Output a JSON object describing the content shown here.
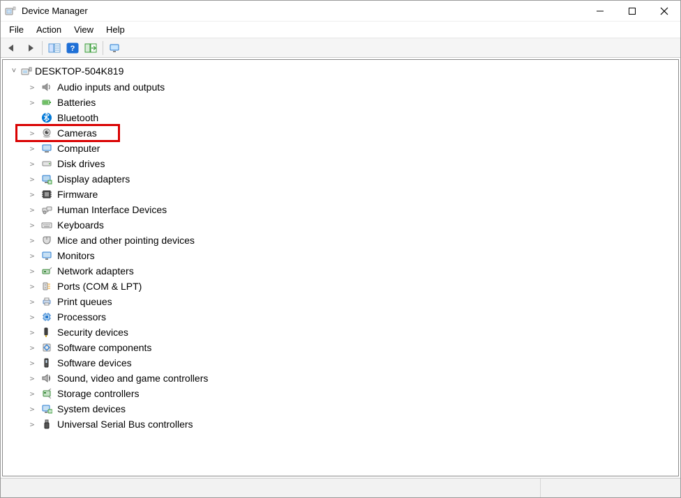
{
  "window": {
    "title": "Device Manager"
  },
  "menu": {
    "file": "File",
    "action": "Action",
    "view": "View",
    "help": "Help"
  },
  "toolbar": {
    "back": "back",
    "forward": "forward",
    "show_hide_console": "show-hide-console-tree",
    "help": "help",
    "scan": "scan-for-hardware-changes",
    "monitor": "display-legacy"
  },
  "tree": {
    "root": "DESKTOP-504K819",
    "categories": [
      {
        "label": "Audio inputs and outputs",
        "icon": "speaker-icon",
        "highlighted": false
      },
      {
        "label": "Batteries",
        "icon": "battery-icon",
        "highlighted": false
      },
      {
        "label": "Bluetooth",
        "icon": "bluetooth-icon",
        "highlighted": false,
        "no_chev": true
      },
      {
        "label": "Cameras",
        "icon": "camera-icon",
        "highlighted": true
      },
      {
        "label": "Computer",
        "icon": "computer-icon",
        "highlighted": false
      },
      {
        "label": "Disk drives",
        "icon": "disk-drive-icon",
        "highlighted": false
      },
      {
        "label": "Display adapters",
        "icon": "display-adapter-icon",
        "highlighted": false
      },
      {
        "label": "Firmware",
        "icon": "firmware-icon",
        "highlighted": false
      },
      {
        "label": "Human Interface Devices",
        "icon": "hid-icon",
        "highlighted": false
      },
      {
        "label": "Keyboards",
        "icon": "keyboard-icon",
        "highlighted": false
      },
      {
        "label": "Mice and other pointing devices",
        "icon": "mouse-icon",
        "highlighted": false
      },
      {
        "label": "Monitors",
        "icon": "monitor-icon",
        "highlighted": false
      },
      {
        "label": "Network adapters",
        "icon": "network-adapter-icon",
        "highlighted": false
      },
      {
        "label": "Ports (COM & LPT)",
        "icon": "ports-icon",
        "highlighted": false
      },
      {
        "label": "Print queues",
        "icon": "printer-icon",
        "highlighted": false
      },
      {
        "label": "Processors",
        "icon": "processor-icon",
        "highlighted": false
      },
      {
        "label": "Security devices",
        "icon": "security-device-icon",
        "highlighted": false
      },
      {
        "label": "Software components",
        "icon": "software-component-icon",
        "highlighted": false
      },
      {
        "label": "Software devices",
        "icon": "software-device-icon",
        "highlighted": false
      },
      {
        "label": "Sound, video and game controllers",
        "icon": "sound-video-icon",
        "highlighted": false
      },
      {
        "label": "Storage controllers",
        "icon": "storage-controller-icon",
        "highlighted": false
      },
      {
        "label": "System devices",
        "icon": "system-device-icon",
        "highlighted": false
      },
      {
        "label": "Universal Serial Bus controllers",
        "icon": "usb-icon",
        "highlighted": false
      }
    ]
  },
  "colors": {
    "highlight": "#d90000",
    "bluetooth": "#0078d7"
  }
}
